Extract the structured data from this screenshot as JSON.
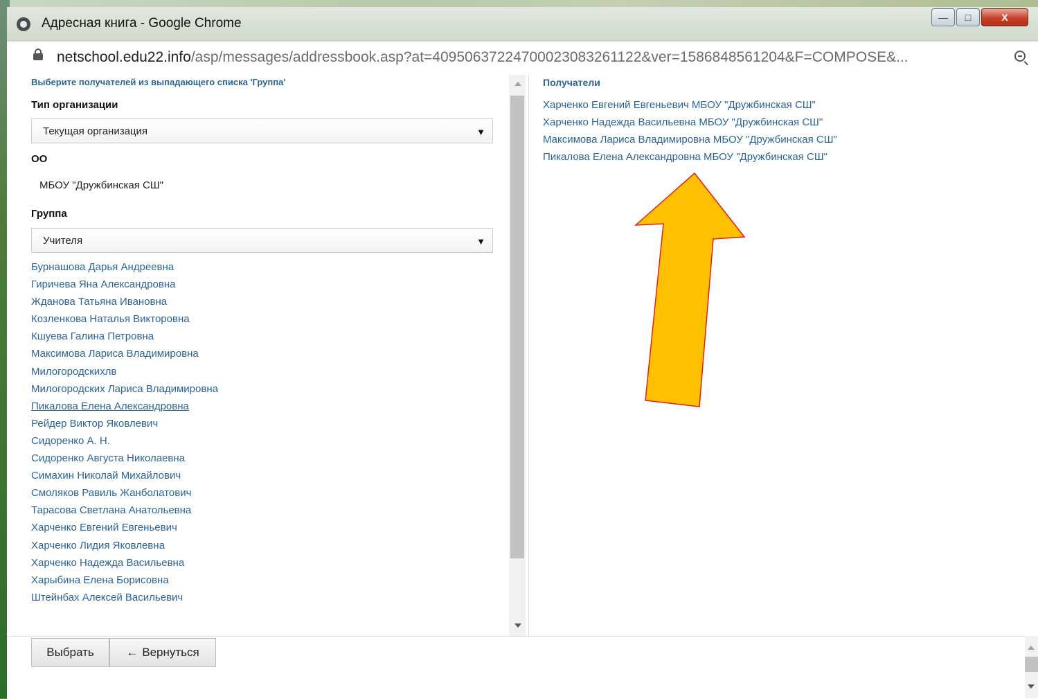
{
  "window": {
    "title": "Адресная книга - Google Chrome",
    "controls": {
      "minimize": "—",
      "maximize": "□",
      "close": "X"
    }
  },
  "address_bar": {
    "host": "netschool.edu22.info",
    "path": "/asp/messages/addressbook.asp?at=4095063722470002308326112​2&ver=1586848561204&F=COMPOSE&..."
  },
  "left": {
    "hint": "Выберите получателей из выпадающего списка 'Группа'",
    "org_type_label": "Тип организации",
    "org_type_value": "Текущая организация",
    "oo_label": "ОО",
    "oo_value": "МБОУ \"Дружбинская СШ\"",
    "group_label": "Группа",
    "group_value": "Учителя",
    "names": [
      "Бурнашова Дарья Андреевна",
      "Гиричева Яна Александровна",
      "Жданова Татьяна Ивановна",
      "Козленкова Наталья Викторовна",
      "Кшуева Галина Петровна",
      "Максимова Лариса Владимировна",
      "Милогородскихлв",
      "Милогородских Лариса Владимировна",
      "Пикалова Елена Александровна",
      "Рейдер Виктор Яковлевич",
      "Сидоренко А. Н.",
      "Сидоренко Августа Николаевна",
      "Симахин Николай Михайлович",
      "Смоляков Равиль Жанболатович",
      "Тарасова Светлана Анатольевна",
      "Харченко Евгений Евгеньевич",
      "Харченко Лидия Яковлевна",
      "Харченко Надежда Васильевна",
      "Харыбина Елена Борисовна",
      "Штейнбах Алексей Васильевич"
    ]
  },
  "right": {
    "title": "Получатели",
    "recipients": [
      "Харченко Евгений Евгеньевич МБОУ \"Дружбинская СШ\"",
      "Харченко Надежда Васильевна МБОУ \"Дружбинская СШ\"",
      "Максимова Лариса Владимировна МБОУ \"Дружбинская СШ\"",
      "Пикалова Елена Александровна МБОУ \"Дружбинская СШ\""
    ]
  },
  "buttons": {
    "select": "Выбрать",
    "back": "Вернуться"
  },
  "icons": {
    "caret": "▼",
    "back_arrow": "←"
  },
  "colors": {
    "link": "#2a6496",
    "annotation_arrow_fill": "#ffc000",
    "annotation_arrow_stroke": "#e02020"
  }
}
